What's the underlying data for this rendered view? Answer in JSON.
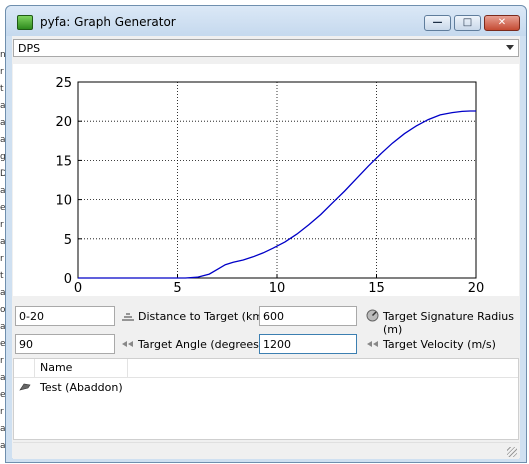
{
  "window": {
    "title": "pyfa: Graph Generator",
    "minimize_glyph": "—",
    "maximize_glyph": "□",
    "close_glyph": "✕"
  },
  "graph_select": {
    "selected": "DPS"
  },
  "chart_data": {
    "type": "line",
    "xlim": [
      0,
      20
    ],
    "ylim": [
      0,
      25
    ],
    "x_ticks": [
      "0",
      "5",
      "10",
      "15",
      "20"
    ],
    "y_ticks": [
      "0",
      "5",
      "10",
      "15",
      "20",
      "25"
    ],
    "grid": true,
    "series": [
      {
        "color": "#0000c8",
        "x": [
          0,
          5.4,
          6.0,
          6.6,
          7.0,
          7.4,
          7.8,
          8.3,
          8.8,
          9.3,
          9.8,
          10.4,
          11.0,
          11.6,
          12.2,
          12.8,
          13.4,
          14.0,
          14.6,
          15.2,
          15.8,
          16.4,
          17.0,
          17.6,
          18.2,
          18.8,
          19.3,
          19.7,
          20.0
        ],
        "y": [
          0,
          0,
          0.1,
          0.5,
          1.1,
          1.7,
          2.0,
          2.3,
          2.7,
          3.2,
          3.8,
          4.6,
          5.6,
          6.8,
          8.1,
          9.6,
          11.1,
          12.7,
          14.3,
          15.8,
          17.2,
          18.4,
          19.4,
          20.2,
          20.8,
          21.1,
          21.25,
          21.3,
          21.3
        ]
      }
    ]
  },
  "controls": {
    "distance": {
      "value": "0-20",
      "label": "Distance to Target (km)"
    },
    "sig_radius": {
      "value": "600",
      "label": "Target Signature Radius (m)"
    },
    "angle": {
      "value": "90",
      "label": "Target Angle (degrees)"
    },
    "velocity": {
      "value": "1200",
      "label": "Target Velocity (m/s)"
    }
  },
  "fit_list": {
    "column_name": "Name",
    "items": [
      {
        "name": "Test (Abaddon)",
        "icon": "ship-icon"
      }
    ]
  },
  "background_letters": [
    "n",
    "r",
    "t",
    "a",
    "a",
    "a",
    "g",
    "D",
    "a",
    "e",
    "r",
    "a",
    "r",
    "t",
    "a",
    "o",
    "a",
    "e",
    "r",
    "a",
    "e",
    "r",
    "a",
    "a"
  ]
}
